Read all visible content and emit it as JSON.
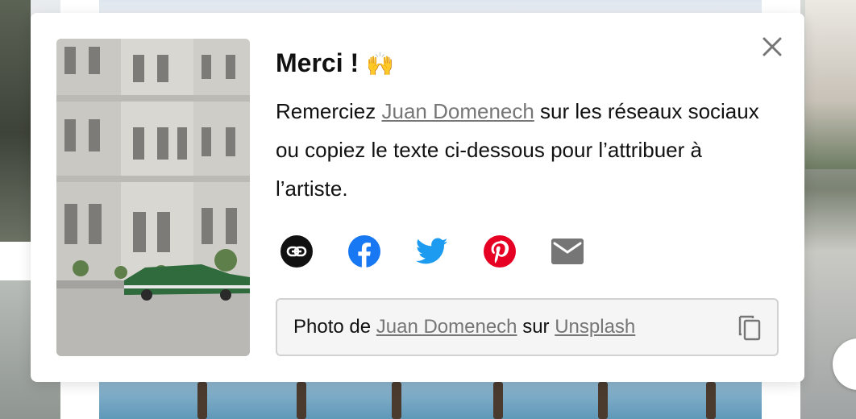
{
  "modal": {
    "title": "Merci !",
    "title_emoji": "🙌",
    "desc_before": "Remerciez ",
    "author_link": "Juan Domenech",
    "desc_after": " sur les réseaux sociaux ou copiez le texte ci-dessous pour l’attribuer à l’artiste.",
    "close_icon": "close-icon"
  },
  "share": [
    {
      "name": "copy-link",
      "icon": "link-icon",
      "color": "#111111"
    },
    {
      "name": "facebook",
      "icon": "facebook-icon",
      "color": "#1877f2"
    },
    {
      "name": "twitter",
      "icon": "twitter-icon",
      "color": "#1d9bf0"
    },
    {
      "name": "pinterest",
      "icon": "pinterest-icon",
      "color": "#e60023"
    },
    {
      "name": "email",
      "icon": "mail-icon",
      "color": "#767676"
    }
  ],
  "attribution": {
    "prefix": "Photo de ",
    "author": "Juan Domenech",
    "middle": " sur ",
    "site": "Unsplash",
    "copy_icon": "copy-icon"
  },
  "colors": {
    "link": "#767676",
    "text": "#111111",
    "box_bg": "#f5f5f5",
    "box_border": "#d1d1d1"
  }
}
